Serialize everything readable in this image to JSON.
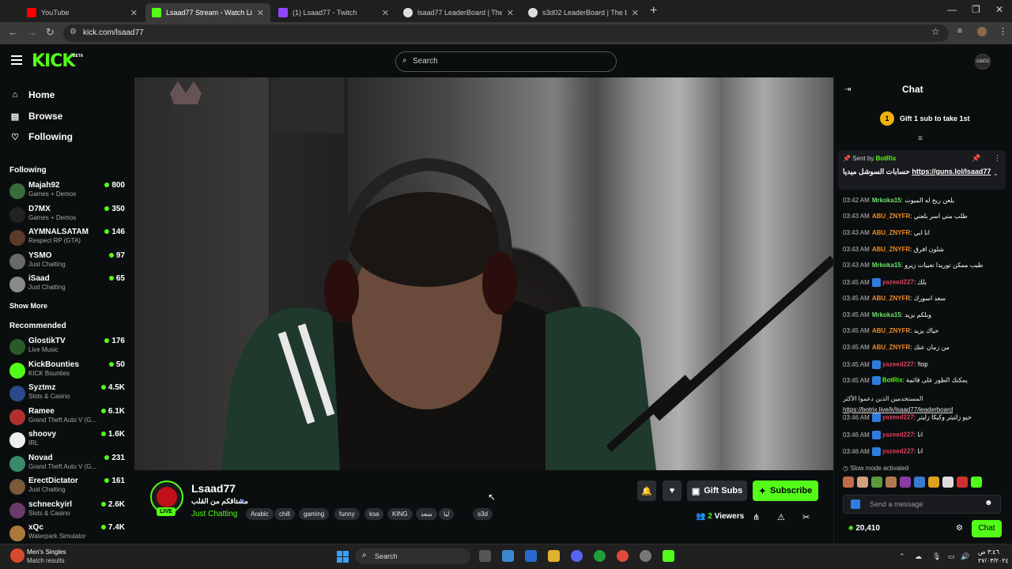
{
  "browser": {
    "tabs": [
      {
        "title": "YouTube",
        "favicon_color": "#ff0000"
      },
      {
        "title": "Lsaad77 Stream - Watch Live on",
        "favicon_color": "#53fc18"
      },
      {
        "title": "(1) Lsaad77 - Twitch",
        "favicon_color": "#9146ff"
      },
      {
        "title": "lsaad77 LeaderBoard | The best",
        "favicon_color": "#dddddd"
      },
      {
        "title": "s3d02 LeaderBoard | The best",
        "favicon_color": "#dddddd"
      }
    ],
    "url": "kick.com/lsaad77"
  },
  "header": {
    "logo": "KICK",
    "beta": "BETA",
    "search_placeholder": "Search",
    "user_avatar_label": "s3d02"
  },
  "sidebar": {
    "nav": [
      {
        "label": "Home",
        "icon": "home-icon"
      },
      {
        "label": "Browse",
        "icon": "browse-icon"
      },
      {
        "label": "Following",
        "icon": "heart-icon"
      }
    ],
    "following_heading": "Following",
    "following": [
      {
        "name": "Majah92",
        "category": "Games + Demos",
        "viewers": "800",
        "color": "#3a6b3a"
      },
      {
        "name": "D7MX",
        "category": "Games + Demos",
        "viewers": "350",
        "color": "#222222"
      },
      {
        "name": "AYMNALSATAM",
        "category": "Respect RP (GTA)",
        "viewers": "146",
        "color": "#5a3a2a"
      },
      {
        "name": "YSMO",
        "category": "Just Chatting",
        "viewers": "97",
        "color": "#6a6a6a"
      },
      {
        "name": "iSaad",
        "category": "Just Chatting",
        "viewers": "65",
        "color": "#8a8a8a"
      }
    ],
    "show_more": "Show More",
    "recommended_heading": "Recommended",
    "recommended": [
      {
        "name": "GlostikTV",
        "category": "Live Music",
        "viewers": "176",
        "color": "#2a5a2a"
      },
      {
        "name": "KickBounties",
        "category": "KICK Bounties",
        "viewers": "50",
        "color": "#53fc18"
      },
      {
        "name": "Syztmz",
        "category": "Slots & Casino",
        "viewers": "4.5K",
        "color": "#2a4a8a"
      },
      {
        "name": "Ramee",
        "category": "Grand Theft Auto V (G...",
        "viewers": "6.1K",
        "color": "#b03030"
      },
      {
        "name": "shoovy",
        "category": "IRL",
        "viewers": "1.6K",
        "color": "#eeeeee"
      },
      {
        "name": "Novad",
        "category": "Grand Theft Auto V (G...",
        "viewers": "231",
        "color": "#3a8a6a"
      },
      {
        "name": "ErectDictator",
        "category": "Just Chatting",
        "viewers": "161",
        "color": "#7a5a3a"
      },
      {
        "name": "schneckyirl",
        "category": "Slots & Casino",
        "viewers": "2.6K",
        "color": "#6a3a6a"
      },
      {
        "name": "xQc",
        "category": "Waterpark Simulator",
        "viewers": "7.4K",
        "color": "#aa7a3a"
      }
    ]
  },
  "stream": {
    "name": "Lsaad77",
    "title": "مشتاقكم من القلب",
    "category": "Just Chatting",
    "live": "LIVE",
    "tags": [
      "Arabic",
      "chill",
      "gaming",
      "funny",
      "ksa",
      "KING",
      "سعد",
      "ليا",
      "s3d"
    ],
    "gift_subs": "Gift Subs",
    "subscribe": "Subscribe",
    "viewers_count": "2",
    "viewers_label": "Viewers"
  },
  "chat": {
    "title": "Chat",
    "gift_rank": "1",
    "gift_text": "Gift 1 sub to take 1st",
    "pinned_sent_by": "Sent by",
    "pinned_user": "BotRix",
    "pinned_text": "حسابات السوشل ميديا",
    "pinned_link": "https://guns.lol/lsaad77",
    "messages": [
      {
        "time": "03:42 AM",
        "user": "Mrkoka15",
        "color": "#6be36b",
        "text": "يلعن ريح له الميوت",
        "badge": false
      },
      {
        "time": "03:43 AM",
        "user": "ABU_ZNYFR",
        "color": "#f08a24",
        "text": "طلب مني اسر بلعني",
        "badge": false
      },
      {
        "time": "03:43 AM",
        "user": "ABU_ZNYFR",
        "color": "#f08a24",
        "text": "انا ابي",
        "badge": false
      },
      {
        "time": "03:43 AM",
        "user": "ABU_ZNYFR",
        "color": "#f08a24",
        "text": "شلون افرق",
        "badge": false
      },
      {
        "time": "03:43 AM",
        "user": "Mrkoka15",
        "color": "#6be36b",
        "text": "طيب ممكن توريدا تعبيات زيرو",
        "badge": false
      },
      {
        "time": "03:45 AM",
        "user": "yazeed227",
        "color": "#e0405a",
        "text": "يلك",
        "badge": true
      },
      {
        "time": "03:45 AM",
        "user": "ABU_ZNYFR",
        "color": "#f08a24",
        "text": "سعد اسورك",
        "badge": false
      },
      {
        "time": "03:45 AM",
        "user": "Mrkoka15",
        "color": "#6be36b",
        "text": "وبلكم يزيد",
        "badge": false
      },
      {
        "time": "03:45 AM",
        "user": "ABU_ZNYFR",
        "color": "#f08a24",
        "text": "حياك يزيد",
        "badge": false
      },
      {
        "time": "03:45 AM",
        "user": "ABU_ZNYFR",
        "color": "#f08a24",
        "text": "من زمان عنك",
        "badge": false
      },
      {
        "time": "03:45 AM",
        "user": "yazeed227",
        "color": "#e0405a",
        "text": "!top",
        "badge": true
      },
      {
        "time": "03:45 AM",
        "user": "BotRix",
        "color": "#53fc18",
        "text": "يمكنك الطور على قائمة",
        "badge": true
      },
      {
        "time": "03:46 AM",
        "user": "yazeed227",
        "color": "#e0405a",
        "text": "حيو زلتيتر وكيكا زليتر",
        "badge": true
      },
      {
        "time": "03:46 AM",
        "user": "yazeed227",
        "color": "#e0405a",
        "text": "انا",
        "badge": true
      },
      {
        "time": "03:46 AM",
        "user": "yazeed227",
        "color": "#e0405a",
        "text": "انا",
        "badge": true
      }
    ],
    "botrix_line2": "المستخدمين الذين دعموا الأكثر",
    "botrix_link": "https://botrix.live/k/lsaad77/leaderboard",
    "slow_mode": "Slow mode activated",
    "message_placeholder": "Send a message",
    "points": "20,410",
    "send_label": "Chat"
  },
  "taskbar": {
    "weather_line1": "Men's Singles",
    "weather_line2": "Match results",
    "search": "Search",
    "clock_line1": "٣:٤٦ ص",
    "clock_line2": "٢٧/٠٣/٢٠٢٤"
  },
  "colors": {
    "accent": "#53fc18",
    "background": "#0b0e0f"
  }
}
